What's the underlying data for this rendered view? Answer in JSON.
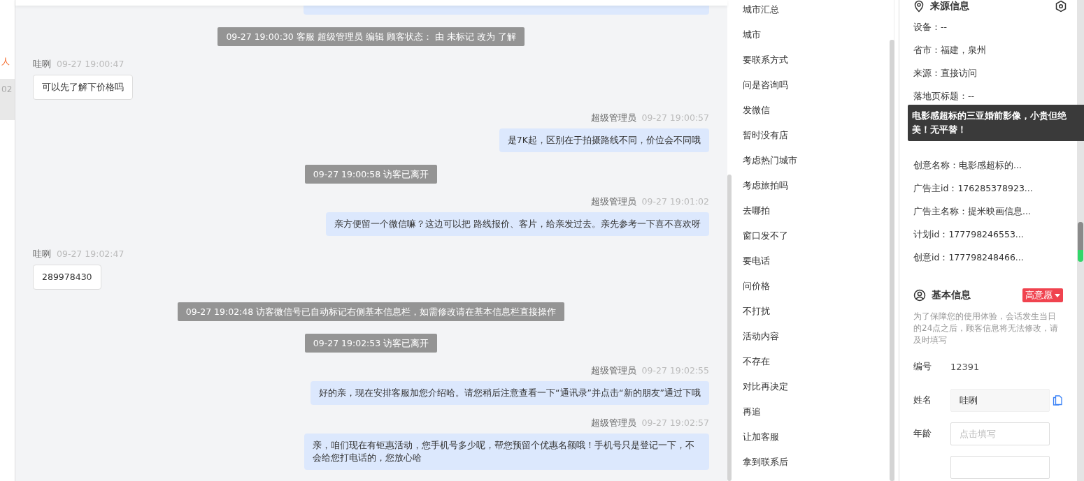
{
  "conversation_list": [
    {
      "text": "人",
      "selected": false
    },
    {
      "text": "02",
      "selected": true
    }
  ],
  "chat": {
    "messages": [
      {
        "kind": "clipped"
      },
      {
        "kind": "notice",
        "text": "09-27 19:00:30 客服 超级管理员 编辑 顾客状态： 由 未标记 改为 了解"
      },
      {
        "kind": "visitor",
        "sender": "哇咧",
        "time": "09-27 19:00:47",
        "text": "可以先了解下价格吗"
      },
      {
        "kind": "agent",
        "sender": "超级管理员",
        "time": "09-27 19:00:57",
        "text": "是7K起，区别在于拍摄路线不同，价位会不同哦"
      },
      {
        "kind": "notice",
        "text": "09-27 19:00:58 访客已离开"
      },
      {
        "kind": "agent",
        "sender": "超级管理员",
        "time": "09-27 19:01:02",
        "text": "亲方便留一个微信嘛？这边可以把  路线报价、客片，给亲发过去。亲先参考一下喜不喜欢呀"
      },
      {
        "kind": "visitor",
        "sender": "哇咧",
        "time": "09-27 19:02:47",
        "text": "289978430"
      },
      {
        "kind": "notice",
        "text": "09-27 19:02:48 访客微信号已自动标记右侧基本信息栏，如需修改请在基本信息栏直接操作"
      },
      {
        "kind": "notice",
        "text": "09-27 19:02:53 访客已离开"
      },
      {
        "kind": "agent",
        "sender": "超级管理员",
        "time": "09-27 19:02:55",
        "text": "好的亲，现在安排客服加您介绍哈。请您稍后注意查看一下“通讯录”并点击“新的朋友”通过下哦"
      },
      {
        "kind": "agent",
        "sender": "超级管理员",
        "time": "09-27 19:02:57",
        "text": "亲，咱们现在有钜惠活动，您手机号多少呢，帮您预留个优惠名额哦！手机号只是登记一下，不会给您打电话的，您放心哈"
      }
    ]
  },
  "quick_replies": [
    "城市汇总",
    "城市",
    "要联系方式",
    "问是咨询吗",
    "发微信",
    "暂时没有店",
    "考虑热门城市",
    "考虑旅拍吗",
    "去哪拍",
    "窗口发不了",
    "要电话",
    "问价格",
    "不打扰",
    "活动内容",
    "不存在",
    "对比再决定",
    "再追",
    "让加客服",
    "拿到联系后"
  ],
  "source_info": {
    "title": "来源信息",
    "rows": [
      {
        "kind": "text",
        "text": "设备：--"
      },
      {
        "kind": "text",
        "text": "省市：福建，泉州"
      },
      {
        "kind": "text",
        "text": "来源：直接访问"
      },
      {
        "kind": "text",
        "text": "落地页标题：--"
      },
      {
        "kind": "tooltip",
        "text": "电影感超标的三亚婚前影像，小贵但绝美！无平替！"
      },
      {
        "kind": "text",
        "text": "创意名称：电影感超标的..."
      },
      {
        "kind": "text",
        "text": "广告主id：176285378923..."
      },
      {
        "kind": "text",
        "text": "广告主名称：提米映画信息..."
      },
      {
        "kind": "text",
        "text": "计划id：177798246553..."
      },
      {
        "kind": "text",
        "text": "创意id：177798248466..."
      }
    ]
  },
  "basic_info": {
    "title": "基本信息",
    "intent_badge": "高意愿",
    "notice": "为了保障您的使用体验，会话发生当日的24点之后，顾客信息将无法修改，请及时填写",
    "fields": [
      {
        "kind": "static",
        "label": "编号",
        "value": "12391"
      },
      {
        "kind": "filled",
        "label": "姓名",
        "value": "哇咧"
      },
      {
        "kind": "input",
        "label": "年龄",
        "placeholder": "点击填写"
      },
      {
        "kind": "input"
      }
    ]
  }
}
